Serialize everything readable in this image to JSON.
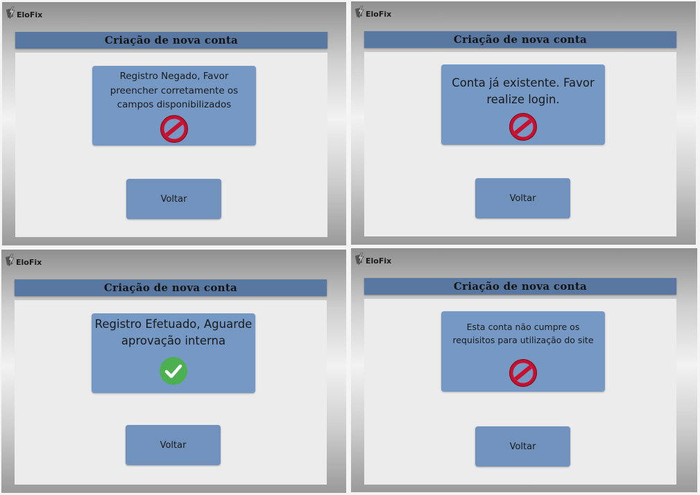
{
  "brand": {
    "name": "EloFix"
  },
  "common": {
    "form_title": "Criação de nova conta",
    "back_label": "Voltar"
  },
  "panels": [
    {
      "message": "Registro Negado, Favor preencher corretamente os campos disponibilizados",
      "status_icon": "prohibited-icon"
    },
    {
      "message": "Conta já existente. Favor realize login.",
      "status_icon": "prohibited-icon"
    },
    {
      "message": "Registro Efetuado, Aguarde aprovação interna",
      "status_icon": "checkmark-icon"
    },
    {
      "message": "Esta conta não cumpre os requisitos para utilização do site",
      "status_icon": "prohibited-icon"
    }
  ],
  "colors": {
    "title_bar": "#5878a2",
    "message_box": "#7599c4",
    "button": "#7192bd",
    "error_red": "#c8102e",
    "success_green": "#4caf50"
  }
}
